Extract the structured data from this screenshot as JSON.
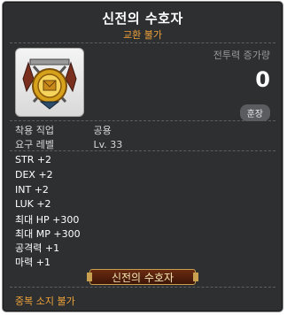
{
  "item": {
    "name": "신전의 수호자",
    "trade_status": "교환 불가",
    "icon": "guardian-emblem-icon",
    "combat_power_label": "전투력 증가량",
    "combat_power_value": "0",
    "badge": "훈장",
    "requirements": [
      {
        "label": "착용 직업",
        "value": "공용"
      },
      {
        "label": "요구 레벨",
        "value": "Lv. 33"
      }
    ],
    "stats": [
      "STR   +2",
      "DEX   +2",
      "INT   +2",
      "LUK   +2",
      "최대 HP   +300",
      "최대 MP   +300",
      "공격력   +1",
      "마력   +1"
    ],
    "medal_name": "신전의 수호자",
    "footer": "중복 소지 불가"
  },
  "colors": {
    "background": "#2e2f31",
    "accent": "#f0a33a",
    "text": "#ffffff"
  }
}
